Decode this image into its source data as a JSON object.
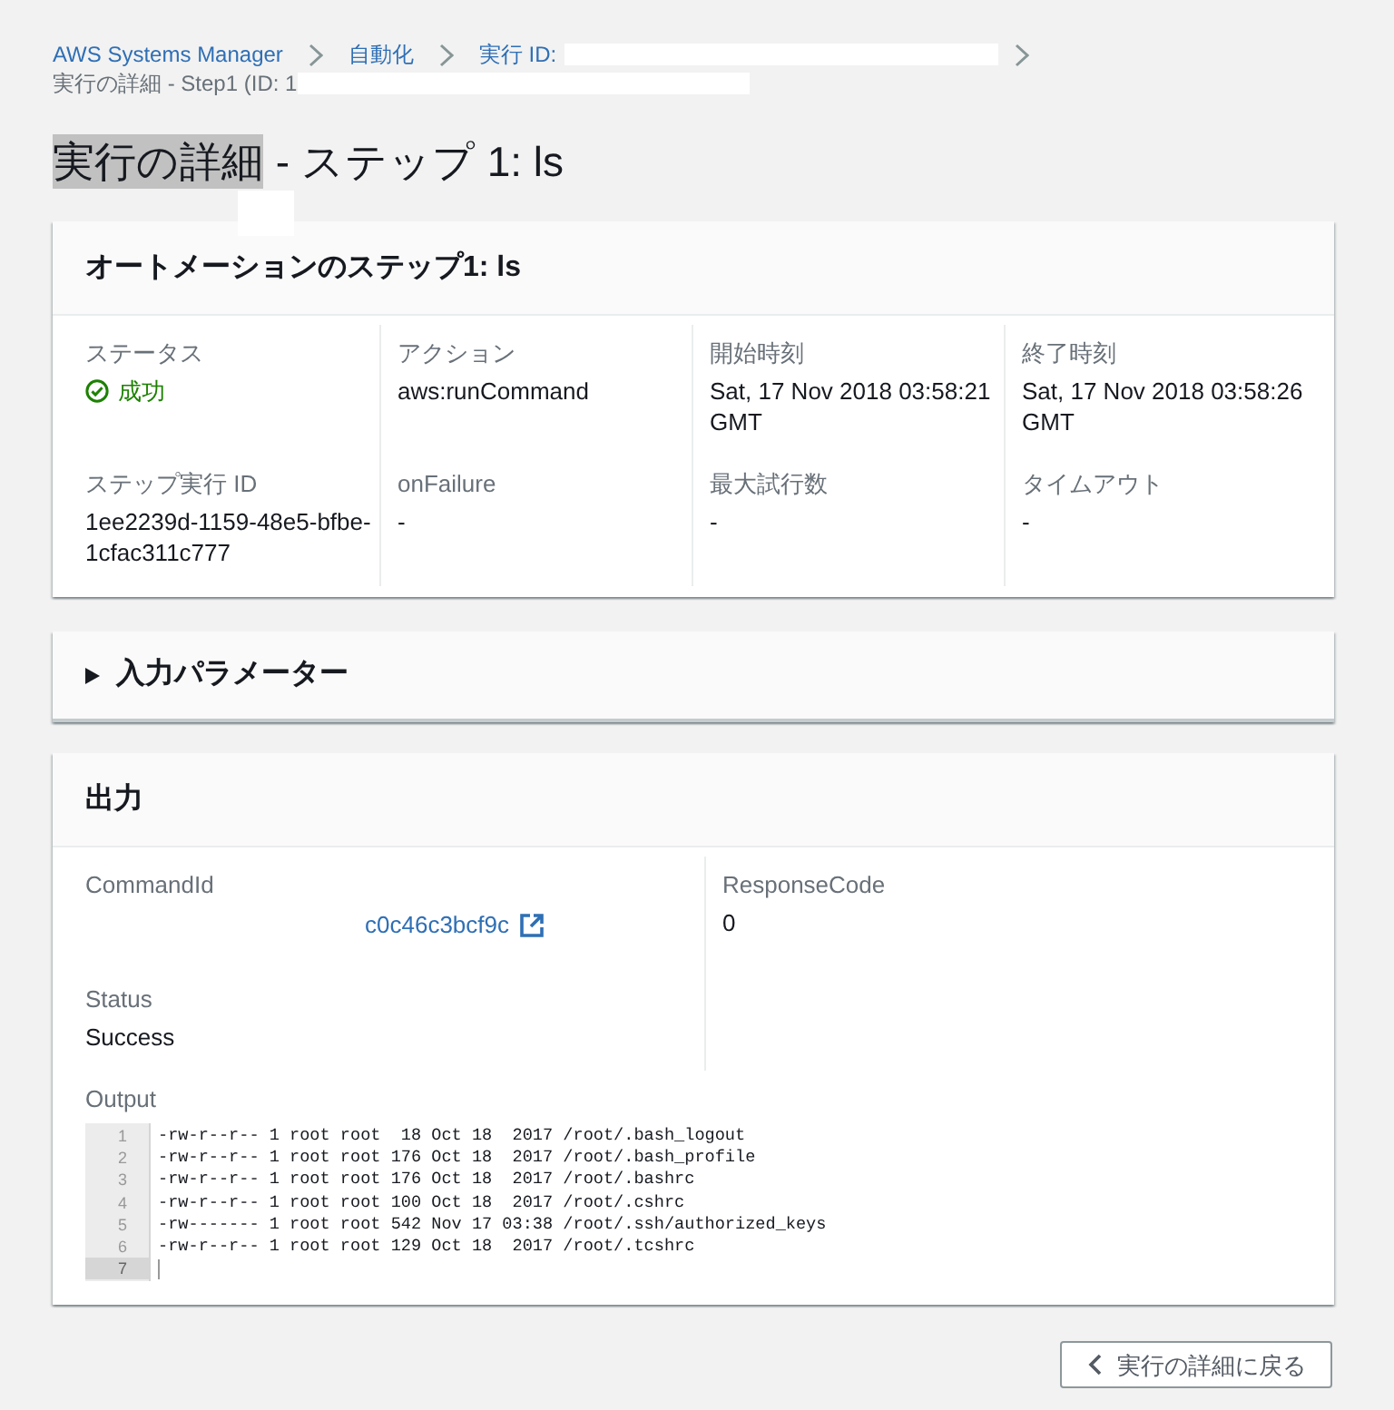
{
  "breadcrumb": {
    "links": [
      {
        "label": "AWS Systems Manager",
        "redacted": false
      },
      {
        "label": "自動化",
        "redacted": false
      },
      {
        "label": "実行 ID:",
        "redacted": true
      }
    ],
    "current": {
      "label": "実行の詳細 - Step1 (ID: 1",
      "redacted": true
    }
  },
  "title": [
    {
      "text": "実行の詳細",
      "selected": true
    },
    {
      "text": "- ステップ 1: ls",
      "selected": false
    }
  ],
  "step_panel": {
    "title": "オートメーションのステップ1: ls",
    "fields": [
      {
        "label": "ステータス",
        "value": "成功",
        "kind": "status"
      },
      {
        "label": "アクション",
        "value": "aws:runCommand",
        "kind": "text"
      },
      {
        "label": "開始時刻",
        "value": "Sat, 17 Nov 2018 03:58:21 GMT",
        "kind": "text"
      },
      {
        "label": "終了時刻",
        "value": "Sat, 17 Nov 2018 03:58:26 GMT",
        "kind": "text"
      },
      {
        "label": "ステップ実行 ID",
        "value": "1ee2239d-1159-48e5-bfbe-1cfac311c777",
        "kind": "text"
      },
      {
        "label": "onFailure",
        "value": "-",
        "kind": "text"
      },
      {
        "label": "最大試行数",
        "value": "-",
        "kind": "text"
      },
      {
        "label": "タイムアウト",
        "value": "-",
        "kind": "text"
      }
    ]
  },
  "input_parameters": {
    "title": "入力パラメーター",
    "expanded": false
  },
  "output_panel": {
    "title": "出力",
    "columns": [
      [
        {
          "label": "CommandId",
          "value": "c0c46c3bcf9c",
          "kind": "link"
        },
        {
          "label": "Status",
          "value": "Success",
          "kind": "text"
        }
      ],
      [
        {
          "label": "ResponseCode",
          "value": "0",
          "kind": "text"
        }
      ]
    ],
    "output_label": "Output",
    "code_lines": [
      {
        "number": "1",
        "text": "-rw-r--r-- 1 root root  18 Oct 18  2017 /root/.bash_logout",
        "selected": false
      },
      {
        "number": "2",
        "text": "-rw-r--r-- 1 root root 176 Oct 18  2017 /root/.bash_profile",
        "selected": false
      },
      {
        "number": "3",
        "text": "-rw-r--r-- 1 root root 176 Oct 18  2017 /root/.bashrc",
        "selected": false
      },
      {
        "number": "4",
        "text": "-rw-r--r-- 1 root root 100 Oct 18  2017 /root/.cshrc",
        "selected": false
      },
      {
        "number": "5",
        "text": "-rw------- 1 root root 542 Nov 17 03:38 /root/.ssh/authorized_keys",
        "selected": false
      },
      {
        "number": "6",
        "text": "-rw-r--r-- 1 root root 129 Oct 18  2017 /root/.tcshrc",
        "selected": false
      },
      {
        "number": "7",
        "selected": true
      }
    ]
  },
  "back_button": {
    "label": "実行の詳細に戻る"
  }
}
